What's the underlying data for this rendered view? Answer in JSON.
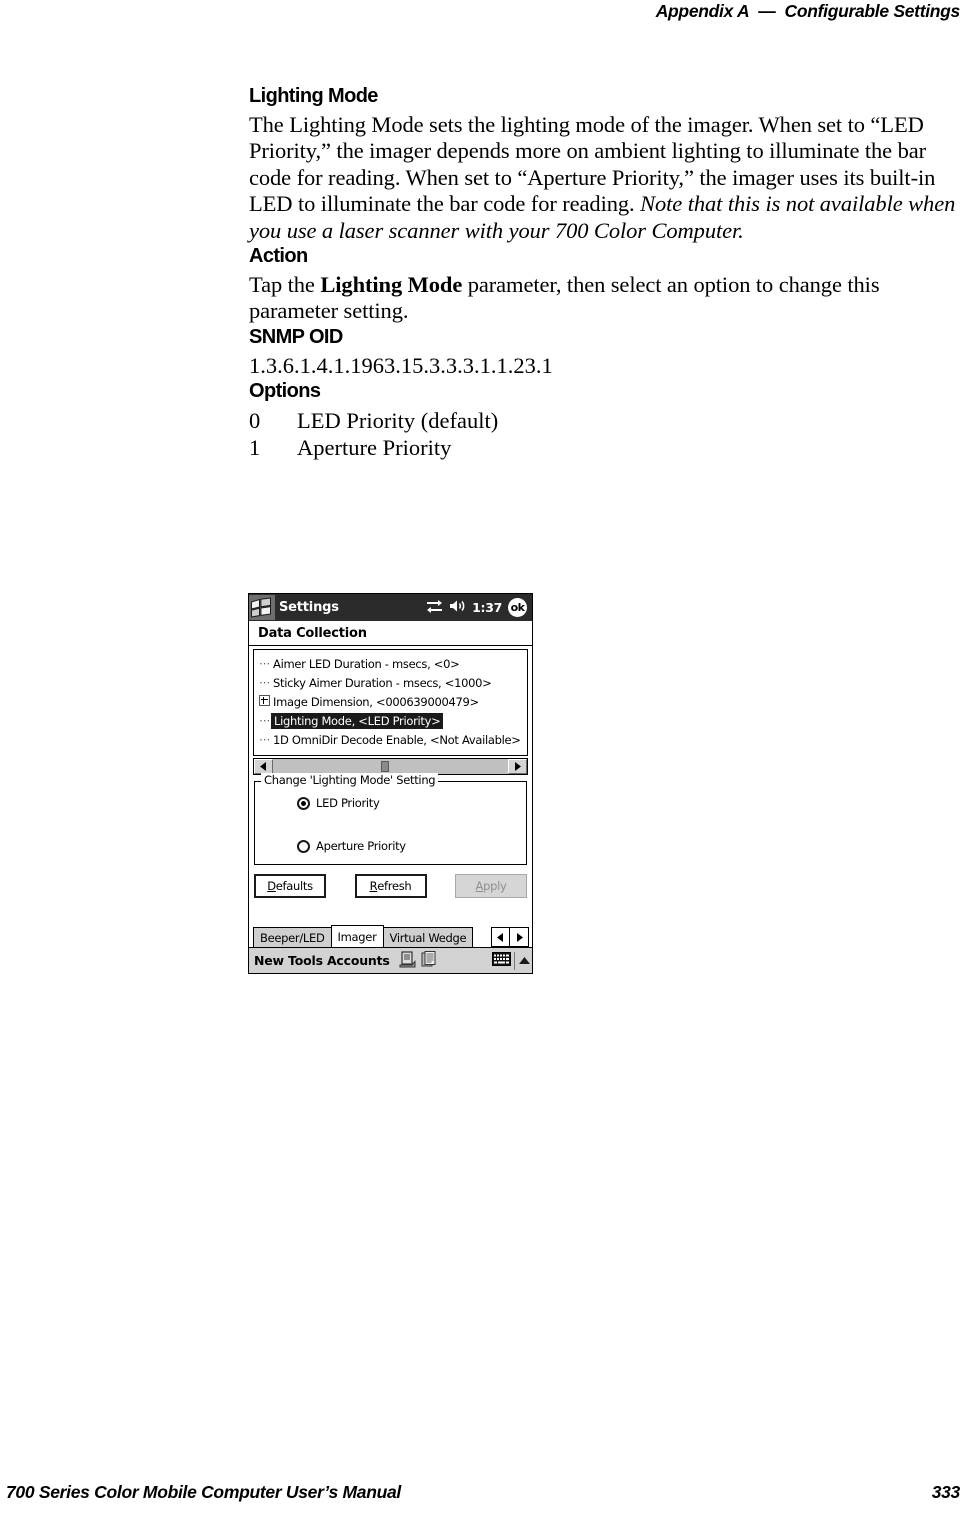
{
  "running_head": {
    "appendix": "Appendix A",
    "separator": "—",
    "title": "Configurable Settings"
  },
  "sections": {
    "lighting_mode": {
      "heading": "Lighting Mode",
      "body_part1": "The Lighting Mode sets the lighting mode of the imager. When set to “LED Priority,” the imager depends more on ambient lighting to illuminate the bar code for reading. When set to “Aperture Priority,” the imager uses its built-in LED to illuminate the bar code for reading. ",
      "body_italic": "Note that this is not available when you use a laser scanner with your 700 Color Computer."
    },
    "action": {
      "heading": "Action",
      "text_before": "Tap the ",
      "bold_term": "Lighting Mode",
      "text_after": " parameter, then select an option to change this parameter setting."
    },
    "snmp_oid": {
      "heading": "SNMP OID",
      "value": "1.3.6.1.4.1.1963.15.3.3.3.1.1.23.1"
    },
    "options": {
      "heading": "Options",
      "items": [
        {
          "num": "0",
          "label": "LED Priority (default)"
        },
        {
          "num": "1",
          "label": "Aperture Priority"
        }
      ]
    }
  },
  "pda": {
    "titlebar": {
      "title": "Settings",
      "time": "1:37",
      "ok_label": "ok"
    },
    "page_heading": "Data Collection",
    "tree_items": [
      {
        "label": "Aimer LED Duration - msecs, <0>",
        "expandable": false,
        "selected": false
      },
      {
        "label": "Sticky Aimer Duration - msecs, <1000>",
        "expandable": false,
        "selected": false
      },
      {
        "label": "Image Dimension, <000639000479>",
        "expandable": true,
        "selected": false
      },
      {
        "label": "Lighting Mode, <LED Priority>",
        "expandable": false,
        "selected": true
      },
      {
        "label": "1D OmniDir Decode Enable, <Not Available>",
        "expandable": false,
        "selected": false
      }
    ],
    "groupbox": {
      "legend": "Change 'Lighting Mode' Setting",
      "options": [
        {
          "label": "LED Priority",
          "checked": true
        },
        {
          "label": "Aperture Priority",
          "checked": false
        }
      ]
    },
    "buttons": [
      {
        "accel": "D",
        "rest": "efaults",
        "disabled": false
      },
      {
        "accel": "R",
        "rest": "efresh",
        "disabled": false
      },
      {
        "accel": "A",
        "rest": "pply",
        "disabled": true
      }
    ],
    "tabs": [
      {
        "label": "Beeper/LED",
        "active": false
      },
      {
        "label": "Imager",
        "active": true
      },
      {
        "label": "Virtual Wedge",
        "active": false
      }
    ],
    "taskbar": {
      "menus": "New Tools Accounts"
    }
  },
  "footer": {
    "manual_title": "700 Series Color Mobile Computer User’s Manual",
    "page_number": "333"
  }
}
